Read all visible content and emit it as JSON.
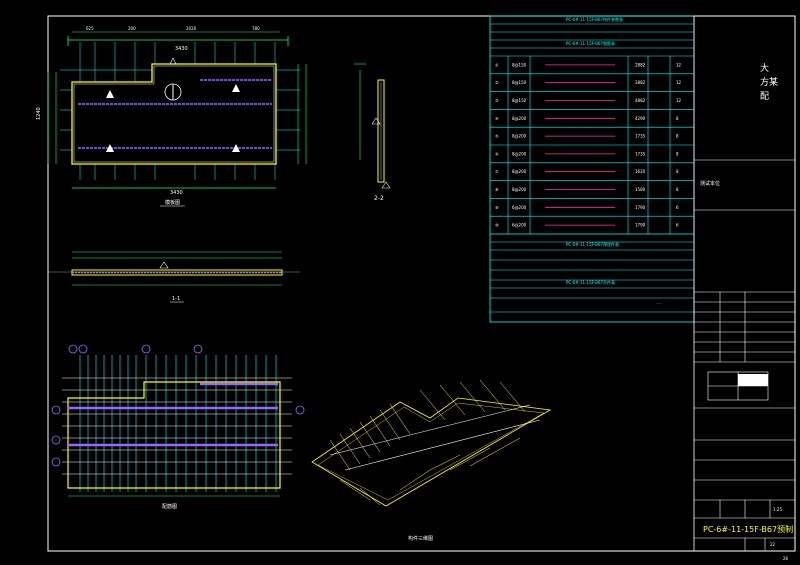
{
  "title_block": {
    "top_right_title": "大 方某 配",
    "line_label": "测试本位",
    "drawing_code": "PC-6#-11-15F-B67预制",
    "scale": "1:25",
    "sheet_no": "22",
    "page_no": "26"
  },
  "views": {
    "section_1_1": "1-1",
    "section_2_2": "2-2",
    "plan_caption": "模板图",
    "rebar_caption": "配筋图",
    "iso_caption": "构件三维图"
  },
  "plan_dims": {
    "overall_width": "3430",
    "overall_height": "1240",
    "segment_a": "1675",
    "segment_b": "1780"
  },
  "table": {
    "header_main": "PC-6#-11-15F-B67构件参数表",
    "rebar_header": "PC-6#-11-15F-B67钢筋表",
    "rows": [
      {
        "id": "①",
        "dia": "8@150",
        "len": "2882",
        "qty": "12"
      },
      {
        "id": "②",
        "dia": "8@150",
        "len": "2882",
        "qty": "12"
      },
      {
        "id": "③",
        "dia": "8@150",
        "len": "4882",
        "qty": "12"
      },
      {
        "id": "④",
        "dia": "8@200",
        "len": "4290",
        "qty": "8"
      },
      {
        "id": "⑤",
        "dia": "8@200",
        "len": "1735",
        "qty": "8"
      },
      {
        "id": "⑥",
        "dia": "8@200",
        "len": "1735",
        "qty": "8"
      },
      {
        "id": "⑦",
        "dia": "8@200",
        "len": "1620",
        "qty": "8"
      },
      {
        "id": "⑧",
        "dia": "8@200",
        "len": "1580",
        "qty": "8"
      },
      {
        "id": "⑨",
        "dia": "6@200",
        "len": "1790",
        "qty": "6"
      },
      {
        "id": "⑩",
        "dia": "6@200",
        "len": "1790",
        "qty": "6"
      }
    ],
    "embed_header": "PC-6#-11-15F-B67预埋件表",
    "lift_header": "PC-6#-11-15F-B67吊件表"
  }
}
